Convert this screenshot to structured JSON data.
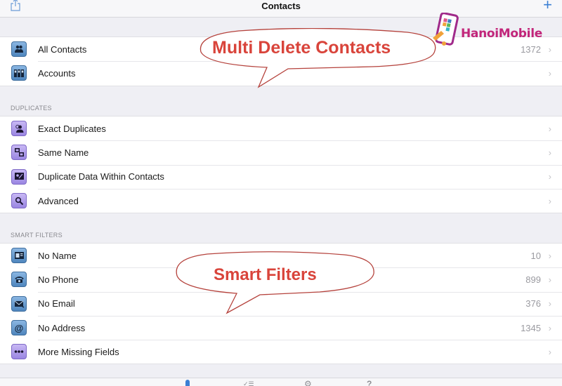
{
  "navbar": {
    "title": "Contacts",
    "share_icon": "share-icon",
    "add_label": "+"
  },
  "sections": {
    "main": {
      "items": [
        {
          "label": "All Contacts",
          "count": "1372",
          "icon": "people-icon",
          "chevron": "›"
        },
        {
          "label": "Accounts",
          "count": "",
          "icon": "accounts-icon",
          "chevron": "›"
        }
      ]
    },
    "duplicates": {
      "header": "DUPLICATES",
      "items": [
        {
          "label": "Exact Duplicates",
          "icon": "duplicate-person-icon",
          "chevron": "›"
        },
        {
          "label": "Same Name",
          "icon": "same-name-icon",
          "chevron": "›"
        },
        {
          "label": "Duplicate Data Within Contacts",
          "icon": "duplicate-data-icon",
          "chevron": "›"
        },
        {
          "label": "Advanced",
          "icon": "search-icon",
          "chevron": "›"
        }
      ]
    },
    "smart_filters": {
      "header": "SMART FILTERS",
      "items": [
        {
          "label": "No Name",
          "count": "10",
          "icon": "no-name-icon",
          "chevron": "›"
        },
        {
          "label": "No Phone",
          "count": "899",
          "icon": "phone-icon",
          "chevron": "›"
        },
        {
          "label": "No Email",
          "count": "376",
          "icon": "email-icon",
          "chevron": "›"
        },
        {
          "label": "No Address",
          "count": "1345",
          "icon": "at-icon",
          "chevron": "›"
        },
        {
          "label": "More Missing Fields",
          "count": "",
          "icon": "more-icon",
          "chevron": "›"
        }
      ]
    }
  },
  "annotations": {
    "callout_top": "Multi Delete Contacts",
    "callout_bottom": "Smart Filters",
    "color": "#d9443b"
  },
  "watermark": {
    "text": "HanoiMobile",
    "color": "#c2267a"
  },
  "tabbar": {
    "tabs": [
      {
        "icon": "contacts-tab-icon",
        "active": true
      },
      {
        "icon": "list-tab-icon",
        "active": false
      },
      {
        "icon": "settings-tab-icon",
        "active": false
      },
      {
        "icon": "help-tab-icon",
        "active": false
      }
    ]
  }
}
